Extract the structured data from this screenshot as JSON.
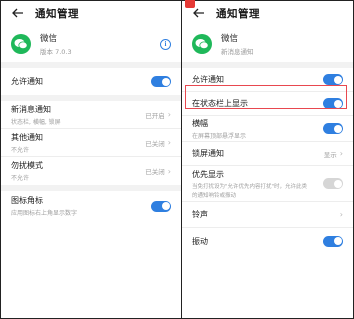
{
  "left": {
    "header": {
      "title": "通知管理"
    },
    "app": {
      "name": "微信",
      "version": "版本 7.0.3"
    },
    "rows": {
      "allow": {
        "label": "允许通知"
      },
      "new_msg": {
        "label": "新消息通知",
        "sub": "状态栏, 横幅, 锁屏",
        "value": "已开启"
      },
      "other": {
        "label": "其他通知",
        "sub": "不允许",
        "value": "已关闭"
      },
      "dnd": {
        "label": "勿扰模式",
        "sub": "不允许",
        "value": "已关闭"
      },
      "badge": {
        "label": "图标角标",
        "sub": "应用图标右上角显示数字"
      }
    }
  },
  "right": {
    "header": {
      "title": "通知管理"
    },
    "app": {
      "name": "微信",
      "sub": "新消息通知"
    },
    "rows": {
      "allow": {
        "label": "允许通知"
      },
      "statusbar": {
        "label": "在状态栏上显示"
      },
      "banner": {
        "label": "横幅",
        "sub": "在屏幕顶部悬浮显示"
      },
      "lockscreen": {
        "label": "锁屏通知",
        "value": "显示"
      },
      "priority": {
        "label": "优先显示",
        "sub1": "当免打扰设为\"允许优先内容打扰\"时，允许此类",
        "sub2": "的通知响铃或振动"
      },
      "ringtone": {
        "label": "铃声"
      },
      "vibrate": {
        "label": "振动"
      }
    }
  },
  "colors": {
    "accent": "#2f7fe0",
    "wechat": "#1fb85a",
    "highlight": "#e8484f"
  },
  "icons": {
    "back": "arrow-left-icon",
    "app": "wechat-icon",
    "info": "info-icon",
    "chevron": "chevron-right-icon"
  }
}
